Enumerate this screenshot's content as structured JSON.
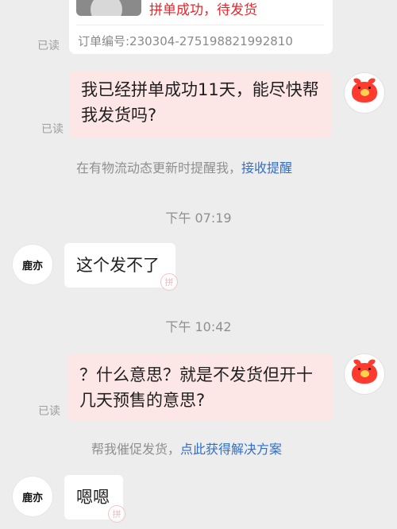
{
  "order": {
    "status": "拼单成功，待发货",
    "number": "订单编号:230304-275198821992810"
  },
  "read_label": "已读",
  "messages": {
    "self_1": "我已经拼单成功11天，能尽快帮我发货吗?",
    "reminder_text": "在有物流动态更新时提醒我，",
    "reminder_link": "接收提醒",
    "time_1": "下午 07:19",
    "other_1": "这个发不了",
    "time_2": "下午 10:42",
    "self_2": "？什么意思？就是不发货但开十几天预售的意思?",
    "urge_text": "帮我催促发货，",
    "urge_link": "点此获得解决方案",
    "other_2": "嗯嗯"
  },
  "avatars": {
    "self_icon": "red-pig-icon",
    "other_label": "鹿亦"
  },
  "stamp_glyph": "拼",
  "colors": {
    "background": "#ededed",
    "self_bubble": "#fde7e6",
    "other_bubble": "#ffffff",
    "status_red": "#e5262b",
    "link_blue": "#2f6fc9"
  }
}
